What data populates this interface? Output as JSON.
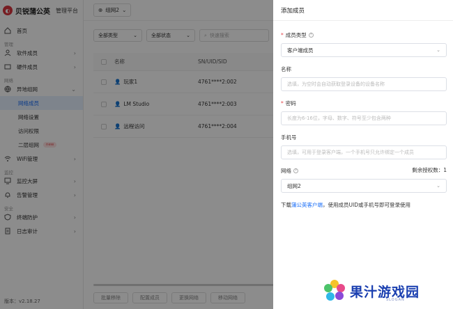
{
  "brand": {
    "name": "贝锐蒲公英",
    "subtitle": "管理平台"
  },
  "sidebar": {
    "home": "首页",
    "sections": {
      "manage": "管理",
      "network": "网络",
      "monitor": "监控",
      "security": "安全"
    },
    "items": {
      "software_members": "软件成员",
      "hardware_members": "硬件成员",
      "remote_network": "异地组网",
      "network_members": "网络成员",
      "network_settings": "网络设置",
      "access_control": "访问权限",
      "layer2_network": "二层组网",
      "new_badge": "new",
      "wifi_manage": "WiFi管理",
      "monitor_screen": "监控大屏",
      "alert_manage": "告警管理",
      "endpoint_protection": "终端防护",
      "log_audit": "日志审计"
    },
    "version": "版本：v2.18.27"
  },
  "topbar": {
    "group": "组网2"
  },
  "filters": {
    "type": "全部类型",
    "status": "全部状态",
    "search_placeholder": "快速搜索"
  },
  "table": {
    "headers": {
      "name": "名称",
      "sn": "SN/UID/SID"
    },
    "rows": [
      {
        "name": "玩家1",
        "sn": "4761****2:002"
      },
      {
        "name": "LM Studio",
        "sn": "4761****2:003"
      },
      {
        "name": "远程访问",
        "sn": "4761****2:004"
      }
    ]
  },
  "bottom_buttons": [
    "批量移除",
    "配置成员",
    "更换网络",
    "移动网络"
  ],
  "drawer": {
    "title": "添加成员",
    "member_type": {
      "label": "成员类型",
      "value": "客户端成员"
    },
    "name": {
      "label": "名称",
      "placeholder": "选填，为空时会自动获取登录设备的设备名称"
    },
    "password": {
      "label": "密码",
      "placeholder": "长度为6-16位，字母、数字、符号至少包含两种"
    },
    "phone": {
      "label": "手机号",
      "placeholder": "选填，可用于登录客户端，一个手机号只允许绑定一个成员"
    },
    "network": {
      "label": "网络",
      "license_label": "剩余授权数：",
      "license_count": "1",
      "value": "组网2"
    },
    "download": {
      "prefix": "下载",
      "link": "蒲公英客户端",
      "suffix": "，使用成员UID或手机号即可登录使用"
    }
  },
  "watermark": {
    "text": "果汁游戏园",
    "slogan": "SLOGAN"
  },
  "colors": {
    "accent": "#1a6ef7",
    "required": "#e5484d",
    "brand": "#d9363e"
  }
}
